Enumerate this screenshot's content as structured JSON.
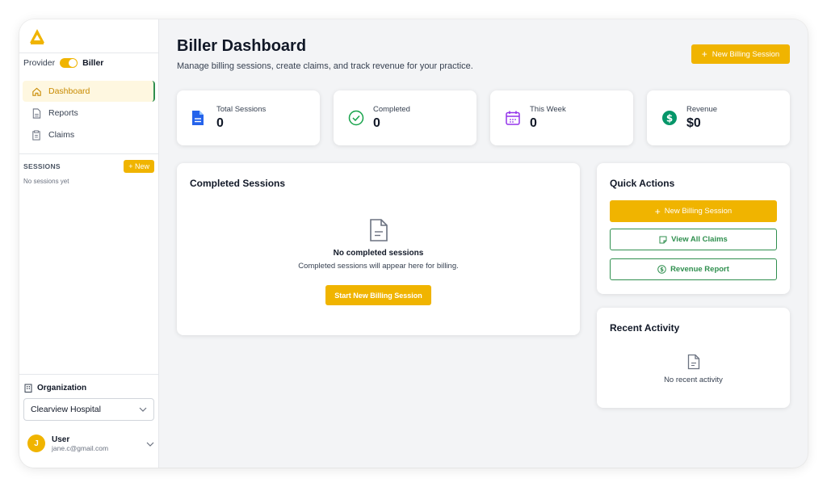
{
  "sidebar": {
    "role_toggle": {
      "left": "Provider",
      "right": "Biller"
    },
    "nav": [
      {
        "label": "Dashboard",
        "icon": "home-icon",
        "active": true
      },
      {
        "label": "Reports",
        "icon": "document-icon",
        "active": false
      },
      {
        "label": "Claims",
        "icon": "clipboard-icon",
        "active": false
      }
    ],
    "sessions": {
      "label": "SESSIONS",
      "new_label": "+ New",
      "empty": "No sessions yet"
    },
    "organization": {
      "label": "Organization",
      "selected": "Clearview Hospital"
    },
    "user": {
      "initial": "J",
      "name": "User",
      "email": "jane.c@gmail.com"
    }
  },
  "header": {
    "title": "Biller Dashboard",
    "subtitle": "Manage billing sessions, create claims, and track revenue for your practice.",
    "new_session_label": "New Billing Session"
  },
  "stats": [
    {
      "label": "Total Sessions",
      "value": "0",
      "icon": "file-icon",
      "color": "#2563eb"
    },
    {
      "label": "Completed",
      "value": "0",
      "icon": "check-circle-icon",
      "color": "#16a34a"
    },
    {
      "label": "This Week",
      "value": "0",
      "icon": "calendar-icon",
      "color": "#9333ea"
    },
    {
      "label": "Revenue",
      "value": "$0",
      "icon": "dollar-icon",
      "color": "#059669"
    }
  ],
  "completed": {
    "title": "Completed Sessions",
    "empty_title": "No completed sessions",
    "empty_sub": "Completed sessions will appear here for billing.",
    "button": "Start New Billing Session"
  },
  "quick_actions": {
    "title": "Quick Actions",
    "new_session": "New Billing Session",
    "view_claims": "View All Claims",
    "revenue_report": "Revenue Report"
  },
  "recent": {
    "title": "Recent Activity",
    "empty": "No recent activity"
  },
  "colors": {
    "accent": "#f0b400",
    "green": "#2f8f4e"
  }
}
